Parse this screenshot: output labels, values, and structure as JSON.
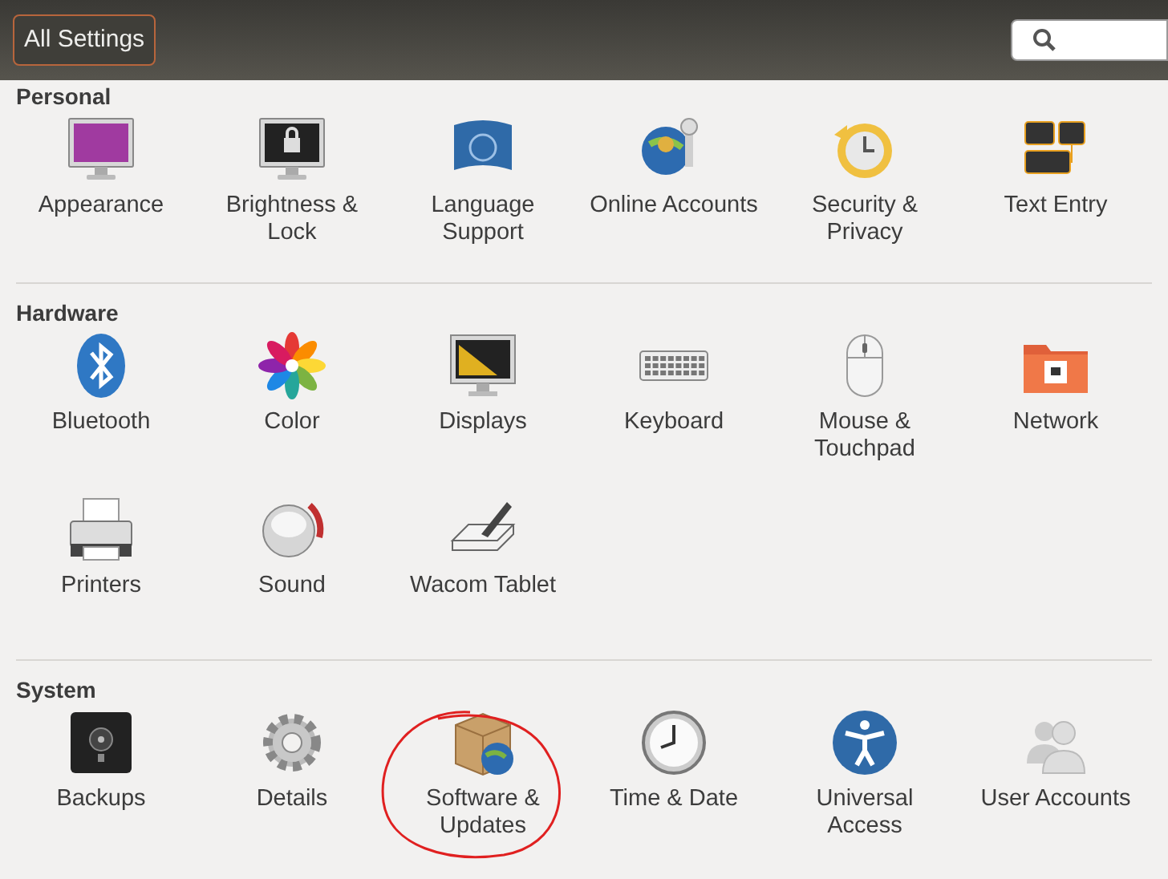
{
  "toolbar": {
    "back_button": "All Settings"
  },
  "sections": [
    {
      "title": "Personal",
      "items": [
        "Appearance",
        "Brightness & Lock",
        "Language Support",
        "Online Accounts",
        "Security & Privacy",
        "Text Entry"
      ]
    },
    {
      "title": "Hardware",
      "items": [
        "Bluetooth",
        "Color",
        "Displays",
        "Keyboard",
        "Mouse & Touchpad",
        "Network",
        "Printers",
        "Sound",
        "Wacom Tablet"
      ]
    },
    {
      "title": "System",
      "items": [
        "Backups",
        "Details",
        "Software & Updates",
        "Time & Date",
        "Universal Access",
        "User Accounts"
      ]
    }
  ]
}
